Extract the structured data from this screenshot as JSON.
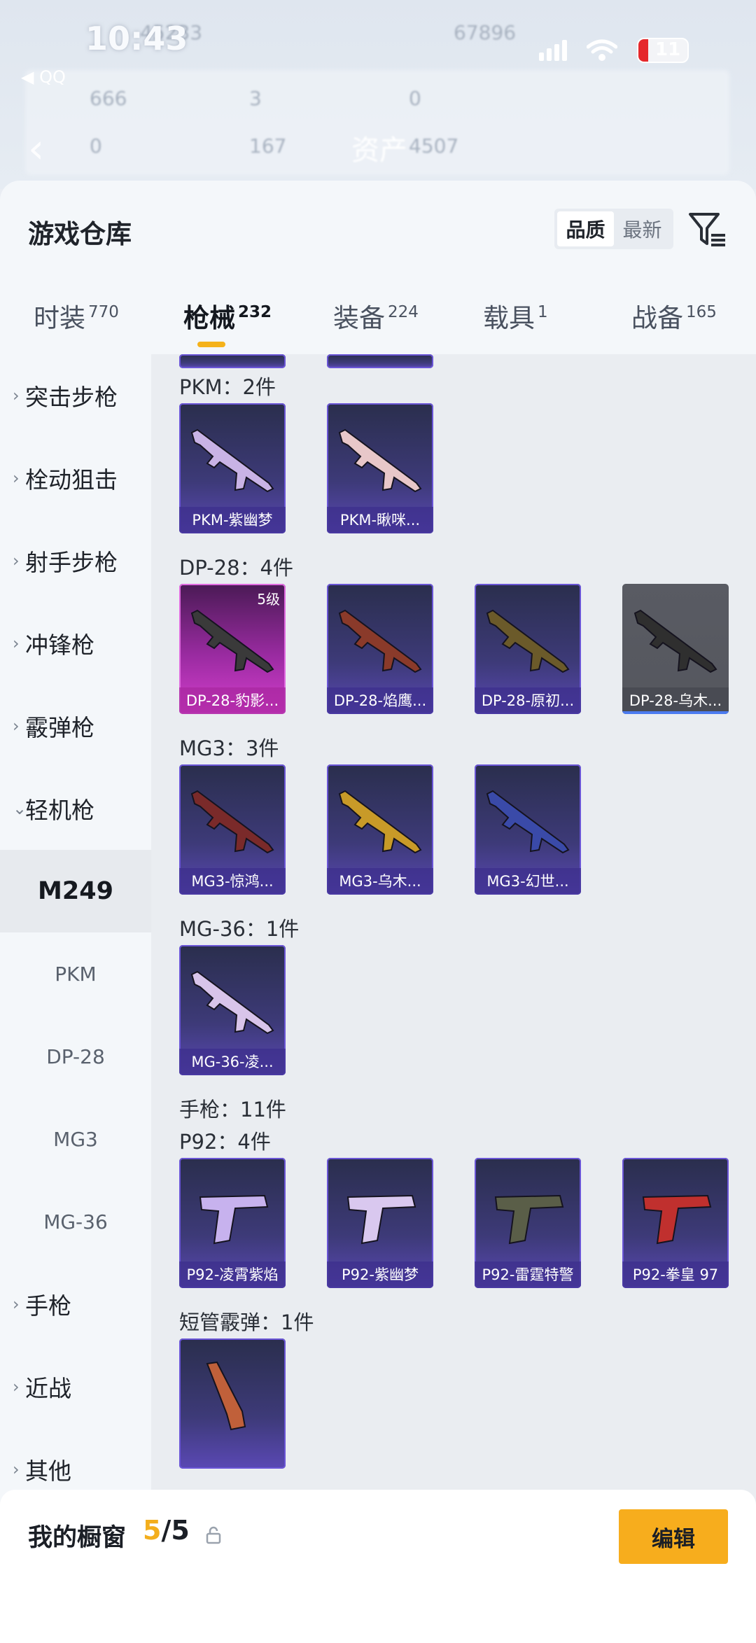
{
  "status_bar": {
    "time": "10:43",
    "battery": "11",
    "back_app": "◀ QQ"
  },
  "background": {
    "label_assets": "资产",
    "ghost_values": [
      "45233",
      "67896",
      "666",
      "3",
      "0",
      "0",
      "167",
      "4507"
    ]
  },
  "header": {
    "title": "游戏仓库",
    "sort_options": [
      "品质",
      "最新"
    ],
    "sort_selected": "品质"
  },
  "tabs": [
    {
      "label": "时装",
      "count": "770"
    },
    {
      "label": "枪械",
      "count": "232"
    },
    {
      "label": "装备",
      "count": "224"
    },
    {
      "label": "载具",
      "count": "1"
    },
    {
      "label": "战备",
      "count": "165"
    }
  ],
  "sidebar": {
    "categories": [
      {
        "label": "突击步枪",
        "expanded": false
      },
      {
        "label": "栓动狙击",
        "expanded": false
      },
      {
        "label": "射手步枪",
        "expanded": false
      },
      {
        "label": "冲锋枪",
        "expanded": false
      },
      {
        "label": "霰弹枪",
        "expanded": false
      },
      {
        "label": "轻机枪",
        "expanded": true
      }
    ],
    "subcategories": [
      {
        "label": "M249",
        "active": true
      },
      {
        "label": "PKM",
        "active": false
      },
      {
        "label": "DP-28",
        "active": false
      },
      {
        "label": "MG3",
        "active": false
      },
      {
        "label": "MG-36",
        "active": false
      }
    ],
    "tail_categories": [
      {
        "label": "手枪"
      },
      {
        "label": "近战"
      },
      {
        "label": "其他"
      }
    ]
  },
  "groups": [
    {
      "title": "PKM：2件",
      "items": [
        {
          "name": "PKM-紫幽梦",
          "style": "purple",
          "icon": "rifle-icon",
          "tint": "#c9b3e6"
        },
        {
          "name": "PKM-瞅咪...",
          "style": "purple",
          "icon": "rifle-icon",
          "tint": "#e8c7c9"
        }
      ]
    },
    {
      "title": "DP-28：4件",
      "items": [
        {
          "name": "DP-28-豹影...",
          "style": "pink",
          "icon": "rifle-icon",
          "tint": "#3a3a3a",
          "level": "5级"
        },
        {
          "name": "DP-28-焰鹰...",
          "style": "purple",
          "icon": "rifle-icon",
          "tint": "#8a3a2a"
        },
        {
          "name": "DP-28-原初...",
          "style": "purple",
          "icon": "rifle-icon",
          "tint": "#6b5a2a"
        },
        {
          "name": "DP-28-乌木...",
          "style": "gray",
          "icon": "rifle-icon",
          "tint": "#2f2f2f"
        }
      ]
    },
    {
      "title": "MG3：3件",
      "items": [
        {
          "name": "MG3-惊鸿...",
          "style": "purple",
          "icon": "rifle-icon",
          "tint": "#7a2a2a"
        },
        {
          "name": "MG3-乌木...",
          "style": "purple",
          "icon": "rifle-icon",
          "tint": "#c89a28"
        },
        {
          "name": "MG3-幻世...",
          "style": "purple",
          "icon": "rifle-icon",
          "tint": "#3a4aa8"
        }
      ]
    },
    {
      "title": "MG-36：1件",
      "items": [
        {
          "name": "MG-36-凌...",
          "style": "purple",
          "icon": "rifle-icon",
          "tint": "#d8c4ea"
        }
      ]
    },
    {
      "title": "手枪：11件",
      "items": []
    },
    {
      "title": "P92：4件",
      "items": [
        {
          "name": "P92-凌霄紫焰",
          "style": "purple",
          "icon": "pistol-icon",
          "tint": "#c7b2ee"
        },
        {
          "name": "P92-紫幽梦",
          "style": "purple",
          "icon": "pistol-icon",
          "tint": "#d9c8ef"
        },
        {
          "name": "P92-雷霆特警",
          "style": "purple",
          "icon": "pistol-icon",
          "tint": "#5a5e48"
        },
        {
          "name": "P92-拳皇 97",
          "style": "purple",
          "icon": "pistol-icon",
          "tint": "#c0302e"
        }
      ]
    },
    {
      "title": "短管霰弹：1件",
      "items": [
        {
          "name": "",
          "style": "purple",
          "icon": "shotgun-icon",
          "tint": "#c0603a"
        }
      ]
    }
  ],
  "fab": {
    "icon": "share-icon"
  },
  "bottom_bar": {
    "title": "我的橱窗",
    "count_used": "5",
    "count_sep_total": "/5",
    "edit_label": "编辑"
  },
  "colors": {
    "accent": "#f7ad1d",
    "card_purple": "#3d3a78",
    "card_pink": "#c23ab8"
  }
}
